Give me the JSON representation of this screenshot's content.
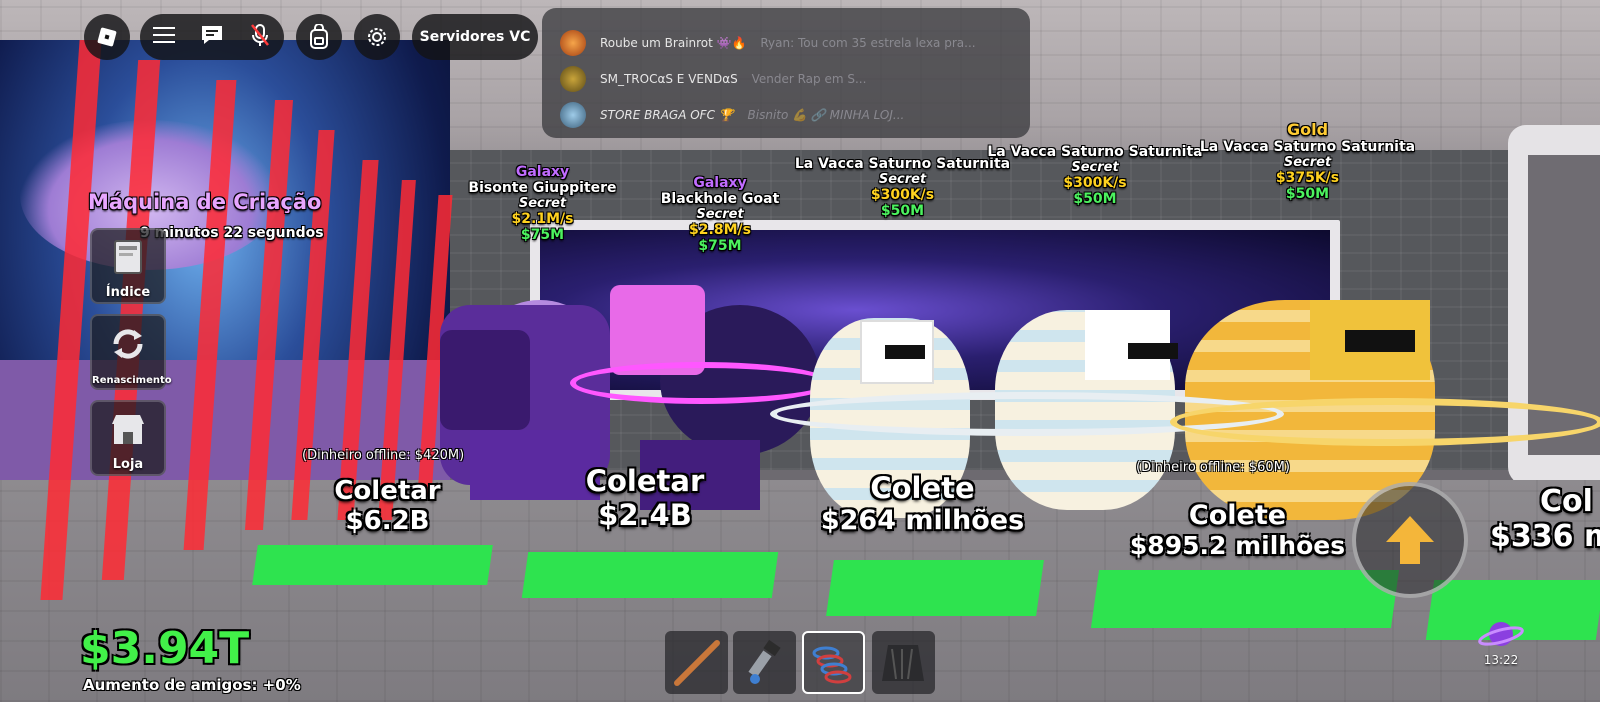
{
  "topbar": {
    "roblox_menu_icon": "roblox-logo-icon",
    "menu_icon": "hamburger-icon",
    "chat_icon": "chat-bubble-icon",
    "mic_icon": "mic-muted-icon",
    "backpack_icon": "backpack-icon",
    "settings_icon": "gear-icon",
    "vc_label": "Servidores VC"
  },
  "chat": {
    "messages": [
      {
        "name": "Roube um Brainrot 👾🔥",
        "text": "Ryan: Tou com 35 estrela lexa pra..."
      },
      {
        "name": "SM_TROCαS E VENDαS",
        "text": "Vender Rap em S..."
      },
      {
        "name": "STORE BRAGA OFC 🏆",
        "text": "Bisnito 💪 🔗 MINHA LOJ..."
      }
    ]
  },
  "machine": {
    "title": "Máquina de Criação",
    "timer": "9 minutos 22 segundos"
  },
  "side_buttons": [
    {
      "label": "Índice",
      "icon": "book-icon"
    },
    {
      "label": "Renascimento",
      "icon": "rebirth-arrows-icon"
    },
    {
      "label": "Loja",
      "icon": "shop-icon"
    }
  ],
  "units": [
    {
      "rarity": "Galaxy",
      "name": "Bisonte Giuppitere",
      "tier": "Secret",
      "rate": "$2.1M/s",
      "price": "$75M",
      "collect_label": "Coletar",
      "collect_value": "$6.2B",
      "offline": "(Dinheiro offline: $420M)"
    },
    {
      "rarity": "Galaxy",
      "name": "Blackhole Goat",
      "tier": "Secret",
      "rate": "$2.8M/s",
      "price": "$75M",
      "collect_label": "Coletar",
      "collect_value": "$2.4B"
    },
    {
      "rarity": "",
      "name": "La Vacca Saturno Saturnita",
      "tier": "Secret",
      "rate": "$300K/s",
      "price": "$50M",
      "collect_label": "Colete",
      "collect_value": "$264 milhões"
    },
    {
      "rarity": "",
      "name": "La Vacca Saturno Saturnita",
      "tier": "Secret",
      "rate": "$300K/s",
      "price": "$50M",
      "collect_label": "Colete",
      "collect_value": "$895.2 milhões",
      "offline": "(Dinheiro offline: $60M)"
    },
    {
      "rarity": "Gold",
      "name": "La Vacca Saturno Saturnita",
      "tier": "Secret",
      "rate": "$375K/s",
      "price": "$50M",
      "collect_label": "Col",
      "collect_value": "$336 m"
    }
  ],
  "hud": {
    "money": "$3.94T",
    "friend_boost": "Aumento de amigos: +0%",
    "clock": "13:22",
    "jump_icon": "up-arrow-icon",
    "planet_icon": "planet-icon"
  },
  "hotbar": [
    {
      "name": "bat",
      "icon": "bat-icon",
      "selected": false
    },
    {
      "name": "grapple",
      "icon": "grapple-gun-icon",
      "selected": false
    },
    {
      "name": "coil",
      "icon": "speed-coil-icon",
      "selected": true
    },
    {
      "name": "cloak",
      "icon": "cloak-icon",
      "selected": false
    }
  ],
  "colors": {
    "money": "#42f049",
    "accent_galaxy": "#c16cff",
    "rate": "#ffd21f",
    "price": "#4cf25f"
  }
}
